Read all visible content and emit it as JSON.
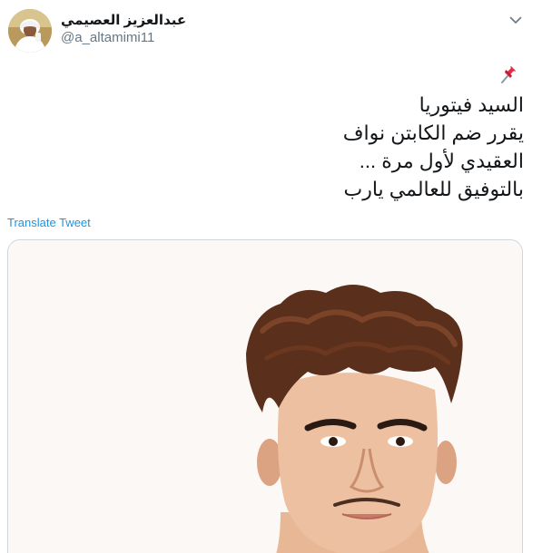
{
  "tweet": {
    "author": {
      "display_name": "عبدالعزيز العصيمي",
      "handle": "@a_altamimi11"
    },
    "icons": {
      "avatar": "user-avatar",
      "pin": "pushpin-icon",
      "menu": "chevron-down-icon"
    },
    "text_lines": [
      "السيد فيتوريا",
      "يقرر ضم الكابتن نواف",
      "العقيدي لأول مرة ...",
      "بالتوفيق للعالمي يارب"
    ],
    "translate_label": "Translate Tweet"
  },
  "colors": {
    "link": "#1b95e0",
    "secondary_text": "#657786",
    "primary_text": "#14171a",
    "border": "#ccd6dd"
  }
}
